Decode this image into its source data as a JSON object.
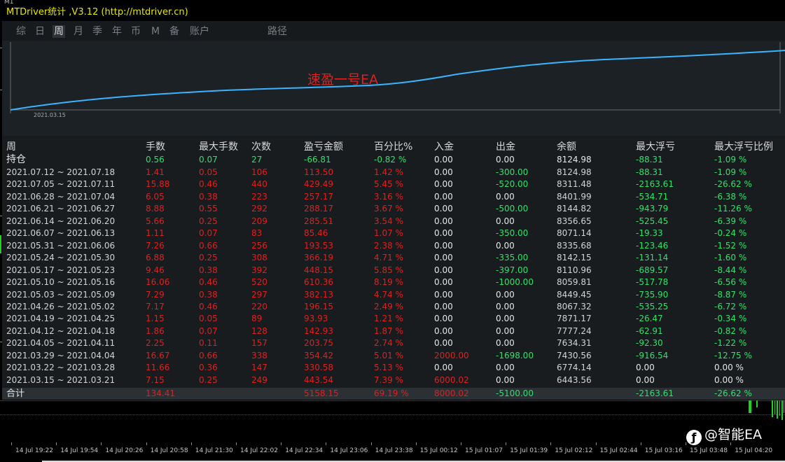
{
  "window": {
    "timeframe_label": "M1",
    "title": "MTDriver统计 ,V3.12 (http://mtdriver.cn)"
  },
  "nav": {
    "items": [
      "综",
      "日",
      "周",
      "月",
      "季",
      "年",
      "币",
      "M",
      "备",
      "账户",
      "路径"
    ],
    "active": "周"
  },
  "chart": {
    "watermark_text": "速盈一号EA",
    "start_date_label": "2021.03.15",
    "line_color": "#3ab4ff"
  },
  "table": {
    "headers": [
      "周",
      "手数",
      "最大手数",
      "次数",
      "盈亏金额",
      "百分比%",
      "入金",
      "出金",
      "余额",
      "最大浮亏",
      "最大浮亏比例"
    ],
    "holding": {
      "label": "持仓",
      "lots": "0.56",
      "max_lots": "0.07",
      "count": "27",
      "pnl": "-66.81",
      "pct": "-0.82 %",
      "deposit": "0.00",
      "withdraw": "0.00",
      "balance": "8124.98",
      "max_dd": "-88.31",
      "max_dd_pct": "-1.09 %"
    },
    "rows": [
      {
        "week": "2021.07.12 ~ 2021.07.18",
        "lots": "1.41",
        "max_lots": "0.05",
        "count": "106",
        "pnl": "113.50",
        "pct": "1.42 %",
        "deposit": "0.00",
        "withdraw": "-300.00",
        "balance": "8124.98",
        "max_dd": "-88.31",
        "max_dd_pct": "-1.09 %"
      },
      {
        "week": "2021.07.05 ~ 2021.07.11",
        "lots": "15.88",
        "max_lots": "0.46",
        "count": "440",
        "pnl": "429.49",
        "pct": "5.45 %",
        "deposit": "0.00",
        "withdraw": "-520.00",
        "balance": "8311.48",
        "max_dd": "-2163.61",
        "max_dd_pct": "-26.62 %"
      },
      {
        "week": "2021.06.28 ~ 2021.07.04",
        "lots": "6.05",
        "max_lots": "0.38",
        "count": "223",
        "pnl": "257.17",
        "pct": "3.16 %",
        "deposit": "0.00",
        "withdraw": "0.00",
        "balance": "8401.99",
        "max_dd": "-534.71",
        "max_dd_pct": "-6.38 %"
      },
      {
        "week": "2021.06.21 ~ 2021.06.27",
        "lots": "8.88",
        "max_lots": "0.55",
        "count": "292",
        "pnl": "288.17",
        "pct": "3.67 %",
        "deposit": "0.00",
        "withdraw": "-500.00",
        "balance": "8144.82",
        "max_dd": "-943.79",
        "max_dd_pct": "-11.26 %"
      },
      {
        "week": "2021.06.14 ~ 2021.06.20",
        "lots": "5.66",
        "max_lots": "0.25",
        "count": "209",
        "pnl": "285.51",
        "pct": "3.54 %",
        "deposit": "0.00",
        "withdraw": "0.00",
        "balance": "8356.65",
        "max_dd": "-525.45",
        "max_dd_pct": "-6.39 %"
      },
      {
        "week": "2021.06.07 ~ 2021.06.13",
        "lots": "1.11",
        "max_lots": "0.07",
        "count": "83",
        "pnl": "85.46",
        "pct": "1.07 %",
        "deposit": "0.00",
        "withdraw": "-350.00",
        "balance": "8071.14",
        "max_dd": "-19.33",
        "max_dd_pct": "-0.24 %"
      },
      {
        "week": "2021.05.31 ~ 2021.06.06",
        "lots": "7.26",
        "max_lots": "0.66",
        "count": "256",
        "pnl": "193.53",
        "pct": "2.38 %",
        "deposit": "0.00",
        "withdraw": "0.00",
        "balance": "8335.68",
        "max_dd": "-123.46",
        "max_dd_pct": "-1.52 %"
      },
      {
        "week": "2021.05.24 ~ 2021.05.30",
        "lots": "6.88",
        "max_lots": "0.25",
        "count": "308",
        "pnl": "366.19",
        "pct": "4.71 %",
        "deposit": "0.00",
        "withdraw": "-335.00",
        "balance": "8142.15",
        "max_dd": "-131.14",
        "max_dd_pct": "-1.60 %"
      },
      {
        "week": "2021.05.17 ~ 2021.05.23",
        "lots": "9.46",
        "max_lots": "0.38",
        "count": "392",
        "pnl": "448.15",
        "pct": "5.85 %",
        "deposit": "0.00",
        "withdraw": "-397.00",
        "balance": "8110.96",
        "max_dd": "-689.57",
        "max_dd_pct": "-8.44 %"
      },
      {
        "week": "2021.05.10 ~ 2021.05.16",
        "lots": "16.06",
        "max_lots": "0.46",
        "count": "520",
        "pnl": "610.36",
        "pct": "8.19 %",
        "deposit": "0.00",
        "withdraw": "-1000.00",
        "balance": "8059.81",
        "max_dd": "-517.78",
        "max_dd_pct": "-6.56 %"
      },
      {
        "week": "2021.05.03 ~ 2021.05.09",
        "lots": "7.29",
        "max_lots": "0.38",
        "count": "297",
        "pnl": "382.13",
        "pct": "4.74 %",
        "deposit": "0.00",
        "withdraw": "0.00",
        "balance": "8449.45",
        "max_dd": "-735.90",
        "max_dd_pct": "-8.87 %"
      },
      {
        "week": "2021.04.26 ~ 2021.05.02",
        "lots": "7.17",
        "max_lots": "0.46",
        "count": "220",
        "pnl": "196.15",
        "pct": "2.49 %",
        "deposit": "0.00",
        "withdraw": "0.00",
        "balance": "8067.32",
        "max_dd": "-535.25",
        "max_dd_pct": "-6.72 %"
      },
      {
        "week": "2021.04.19 ~ 2021.04.25",
        "lots": "1.15",
        "max_lots": "0.05",
        "count": "89",
        "pnl": "93.93",
        "pct": "1.21 %",
        "deposit": "0.00",
        "withdraw": "0.00",
        "balance": "7871.17",
        "max_dd": "-26.47",
        "max_dd_pct": "-0.34 %"
      },
      {
        "week": "2021.04.12 ~ 2021.04.18",
        "lots": "1.86",
        "max_lots": "0.07",
        "count": "128",
        "pnl": "142.93",
        "pct": "1.87 %",
        "deposit": "0.00",
        "withdraw": "0.00",
        "balance": "7777.24",
        "max_dd": "-62.91",
        "max_dd_pct": "-0.82 %"
      },
      {
        "week": "2021.04.05 ~ 2021.04.11",
        "lots": "2.25",
        "max_lots": "0.11",
        "count": "157",
        "pnl": "203.75",
        "pct": "2.74 %",
        "deposit": "0.00",
        "withdraw": "0.00",
        "balance": "7634.31",
        "max_dd": "-92.30",
        "max_dd_pct": "-1.22 %"
      },
      {
        "week": "2021.03.29 ~ 2021.04.04",
        "lots": "16.67",
        "max_lots": "0.66",
        "count": "338",
        "pnl": "354.42",
        "pct": "5.01 %",
        "deposit": "2000.00",
        "withdraw": "-1698.00",
        "balance": "7430.56",
        "max_dd": "-916.54",
        "max_dd_pct": "-12.75 %"
      },
      {
        "week": "2021.03.22 ~ 2021.03.28",
        "lots": "11.66",
        "max_lots": "0.36",
        "count": "147",
        "pnl": "330.58",
        "pct": "5.13 %",
        "deposit": "0.00",
        "withdraw": "0.00",
        "balance": "6774.14",
        "max_dd": "0.00",
        "max_dd_pct": "0.00 %"
      },
      {
        "week": "2021.03.15 ~ 2021.03.21",
        "lots": "7.15",
        "max_lots": "0.25",
        "count": "249",
        "pnl": "443.54",
        "pct": "7.39 %",
        "deposit": "6000.02",
        "withdraw": "0.00",
        "balance": "6443.56",
        "max_dd": "0.00",
        "max_dd_pct": "0.00 %"
      }
    ],
    "summary": {
      "label": "合计",
      "lots": "134.41",
      "pnl": "5158.15",
      "pct": "69.19 %",
      "deposit": "8000.02",
      "withdraw": "-5100.00",
      "max_dd": "-2163.61",
      "max_dd_pct": "-26.62 %"
    }
  },
  "time_axis": {
    "labels": [
      "14 Jul 19:22",
      "14 Jul 19:54",
      "14 Jul 20:26",
      "14 Jul 20:58",
      "14 Jul 21:30",
      "14 Jul 22:02",
      "14 Jul 22:34",
      "14 Jul 23:06",
      "14 Jul 23:38",
      "15 Jul 00:12",
      "15 Jul 01:07",
      "15 Jul 01:39",
      "15 Jul 02:12",
      "15 Jul 02:44",
      "15 Jul 03:16",
      "15 Jul 03:48",
      "15 Jul 04:20"
    ]
  },
  "watermark": {
    "text": "@智能EA"
  }
}
